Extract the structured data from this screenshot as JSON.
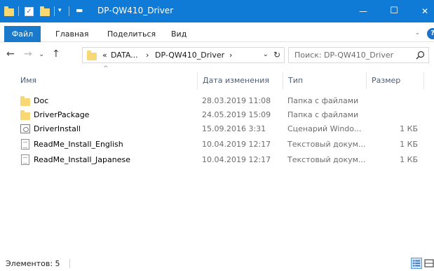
{
  "window": {
    "title": "DP-QW410_Driver",
    "title_bar_color": "#0f7bd6",
    "minimize_glyph": "—",
    "maximize_glyph": "☐",
    "close_glyph": "✕"
  },
  "qat": {
    "dropdown_glyph": "▾"
  },
  "ribbon": {
    "file_tab": "Файл",
    "tabs": [
      "Главная",
      "Поделиться",
      "Вид"
    ],
    "expand_glyph": "⌄",
    "help_glyph": "?"
  },
  "nav": {
    "back_glyph": "←",
    "forward_glyph": "→",
    "recent_glyph": "⌄",
    "up_glyph": "↑"
  },
  "address": {
    "overflow": "«",
    "crumb_1": "DATA...",
    "separator": "›",
    "crumb_2": "DP-QW410_Driver",
    "dropdown_glyph": "⌄",
    "refresh_glyph": "↻"
  },
  "search": {
    "placeholder": "Поиск: DP-QW410_Driver"
  },
  "columns": {
    "name": "Имя",
    "date": "Дата изменения",
    "type": "Тип",
    "size": "Размер",
    "sort_glyph": "^"
  },
  "files": [
    {
      "name": "Doc",
      "date": "28.03.2019 11:08",
      "type": "Папка с файлами",
      "size": "",
      "icon": "folder-icon"
    },
    {
      "name": "DriverPackage",
      "date": "24.05.2019 15:09",
      "type": "Папка с файлами",
      "size": "",
      "icon": "folder-icon"
    },
    {
      "name": "DriverInstall",
      "date": "15.09.2016 3:31",
      "type": "Сценарий Windo...",
      "size": "1 КБ",
      "icon": "script-icon"
    },
    {
      "name": "ReadMe_Install_English",
      "date": "10.04.2019 12:17",
      "type": "Текстовый докум...",
      "size": "1 КБ",
      "icon": "text-file-icon"
    },
    {
      "name": "ReadMe_Install_Japanese",
      "date": "10.04.2019 12:17",
      "type": "Текстовый докум...",
      "size": "1 КБ",
      "icon": "text-file-icon"
    }
  ],
  "status": {
    "items_count": "Элементов: 5"
  }
}
